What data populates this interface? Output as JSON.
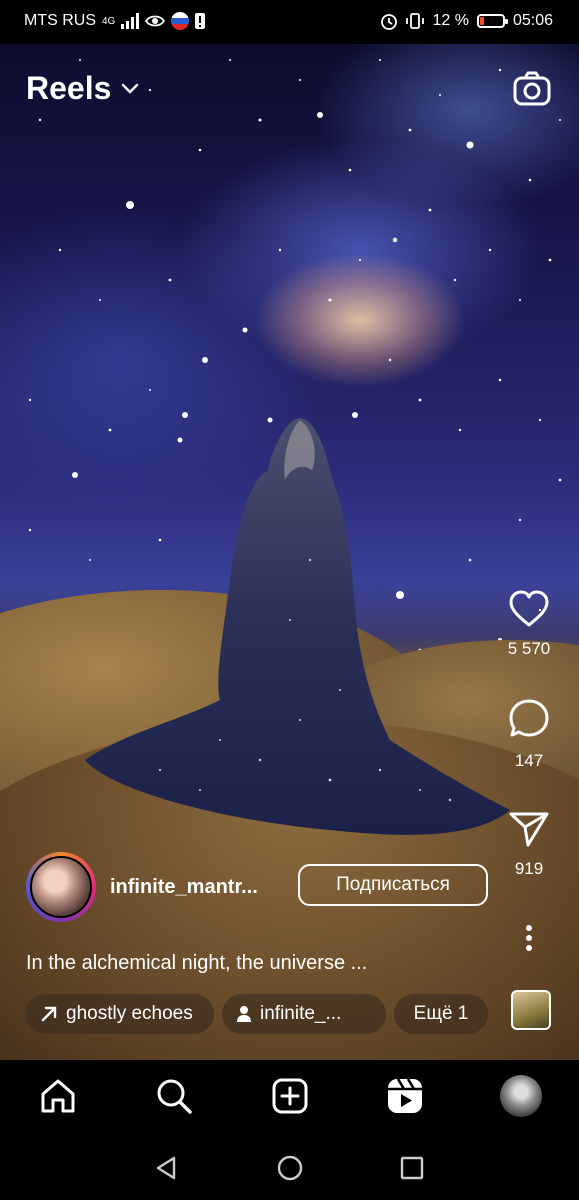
{
  "status_bar": {
    "carrier": "MTS RUS",
    "network": "4G",
    "battery_percent": "12 %",
    "time": "05:06"
  },
  "header": {
    "title": "Reels",
    "dropdown_icon": "chevron-down-icon",
    "camera_icon": "camera-icon"
  },
  "actions": {
    "like": {
      "icon": "heart-icon",
      "count": "5 570"
    },
    "comment": {
      "icon": "comment-icon",
      "count": "147"
    },
    "share": {
      "icon": "send-icon",
      "count": "919"
    },
    "more_icon": "more-vertical-icon"
  },
  "post": {
    "username": "infinite_mantr...",
    "follow_label": "Подписаться",
    "caption": "In the alchemical night, the universe ...",
    "chips": {
      "audio": "ghostly echoes",
      "tagged": "infinite_...",
      "more": "Ещё 1"
    }
  },
  "bottom_nav": {
    "items": [
      "home-icon",
      "search-icon",
      "create-icon",
      "reels-icon",
      "profile-avatar"
    ]
  },
  "system_nav": {
    "items": [
      "back-icon",
      "home-circle-icon",
      "recents-icon"
    ]
  },
  "colors": {
    "background": "#000000",
    "text": "#ffffff",
    "battery_low": "#ff4b2b"
  }
}
